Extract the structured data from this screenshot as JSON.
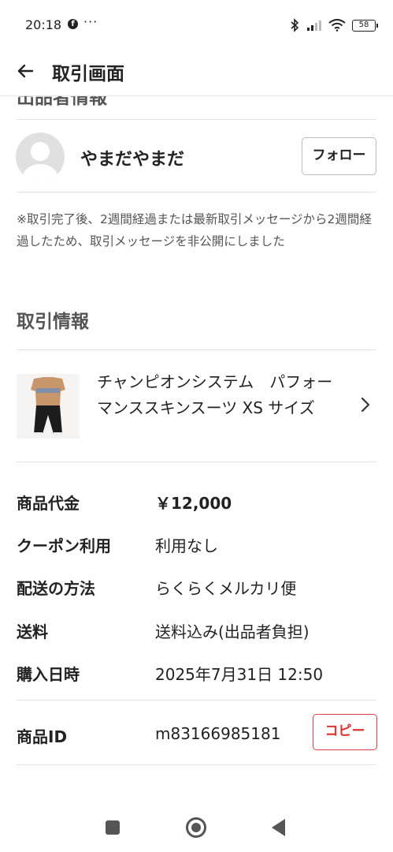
{
  "status_bar": {
    "time": "20:18",
    "facebook_icon_letter": "f",
    "more": "···",
    "battery": "58"
  },
  "app_bar": {
    "title": "取引画面"
  },
  "seller": {
    "cut_heading": "出品者情報",
    "name": "やまだやまだ",
    "follow_label": "フォロー"
  },
  "notice": "※取引完了後、2週間経過または最新取引メッセージから2週間経過したため、取引メッセージを非公開にしました",
  "transaction": {
    "section_title": "取引情報",
    "product_name": "チャンピオンシステム　パフォーマンススキンスーツ XS サイズ",
    "rows": [
      {
        "label": "商品代金",
        "value": "￥12,000"
      },
      {
        "label": "クーポン利用",
        "value": "利用なし"
      },
      {
        "label": "配送の方法",
        "value": "らくらくメルカリ便"
      },
      {
        "label": "送料",
        "value": "送料込み(出品者負担)"
      },
      {
        "label": "購入日時",
        "value": "2025年7月31日 12:50"
      }
    ],
    "item_id_label": "商品ID",
    "item_id_value": "m83166985181",
    "copy_label": "コピー"
  },
  "colors": {
    "accent_red": "#e03030",
    "text": "#222222",
    "muted": "#555555"
  }
}
